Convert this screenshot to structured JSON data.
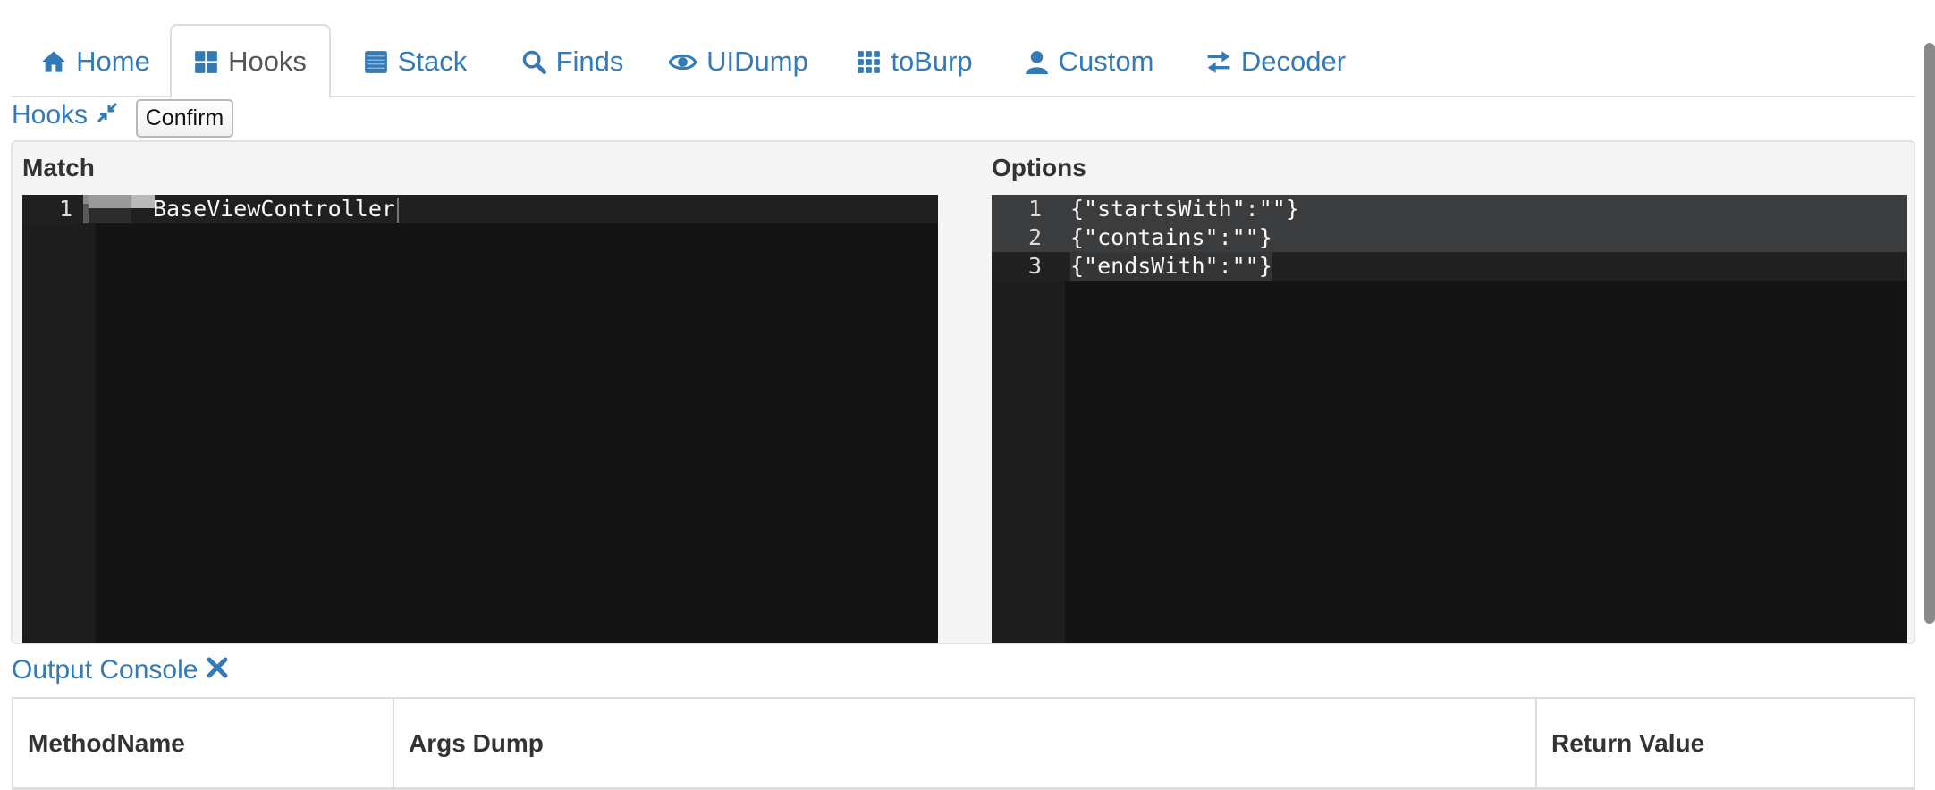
{
  "tabs": [
    {
      "label": "Home",
      "icon": "home-icon",
      "active": false
    },
    {
      "label": "Hooks",
      "icon": "grid-large-icon",
      "active": true
    },
    {
      "label": "Stack",
      "icon": "stack-icon",
      "active": false
    },
    {
      "label": "Finds",
      "icon": "search-icon",
      "active": false
    },
    {
      "label": "UIDump",
      "icon": "eye-icon",
      "active": false
    },
    {
      "label": "toBurp",
      "icon": "grid-small-icon",
      "active": false
    },
    {
      "label": "Custom",
      "icon": "user-icon",
      "active": false
    },
    {
      "label": "Decoder",
      "icon": "transfer-icon",
      "active": false
    }
  ],
  "hooks": {
    "title": "Hooks",
    "title_icon": "collapse-arrows-icon",
    "confirm_label": "Confirm"
  },
  "match": {
    "label": "Match",
    "lines": [
      {
        "num": "1",
        "code": "BaseViewController"
      }
    ]
  },
  "options": {
    "label": "Options",
    "lines": [
      {
        "num": "1",
        "code": "{\"startsWith\":\"\"}"
      },
      {
        "num": "2",
        "code": "{\"contains\":\"\"}"
      },
      {
        "num": "3",
        "code": "{\"endsWith\":\"\"}"
      }
    ]
  },
  "output": {
    "title": "Output Console",
    "title_icon": "close-icon",
    "columns": [
      "MethodName",
      "Args Dump",
      "Return Value"
    ]
  },
  "colors": {
    "link": "#337ab7",
    "editor_bg": "#141414",
    "gutter_bg": "#1d1d1d",
    "selection": "#3a3c3e"
  }
}
